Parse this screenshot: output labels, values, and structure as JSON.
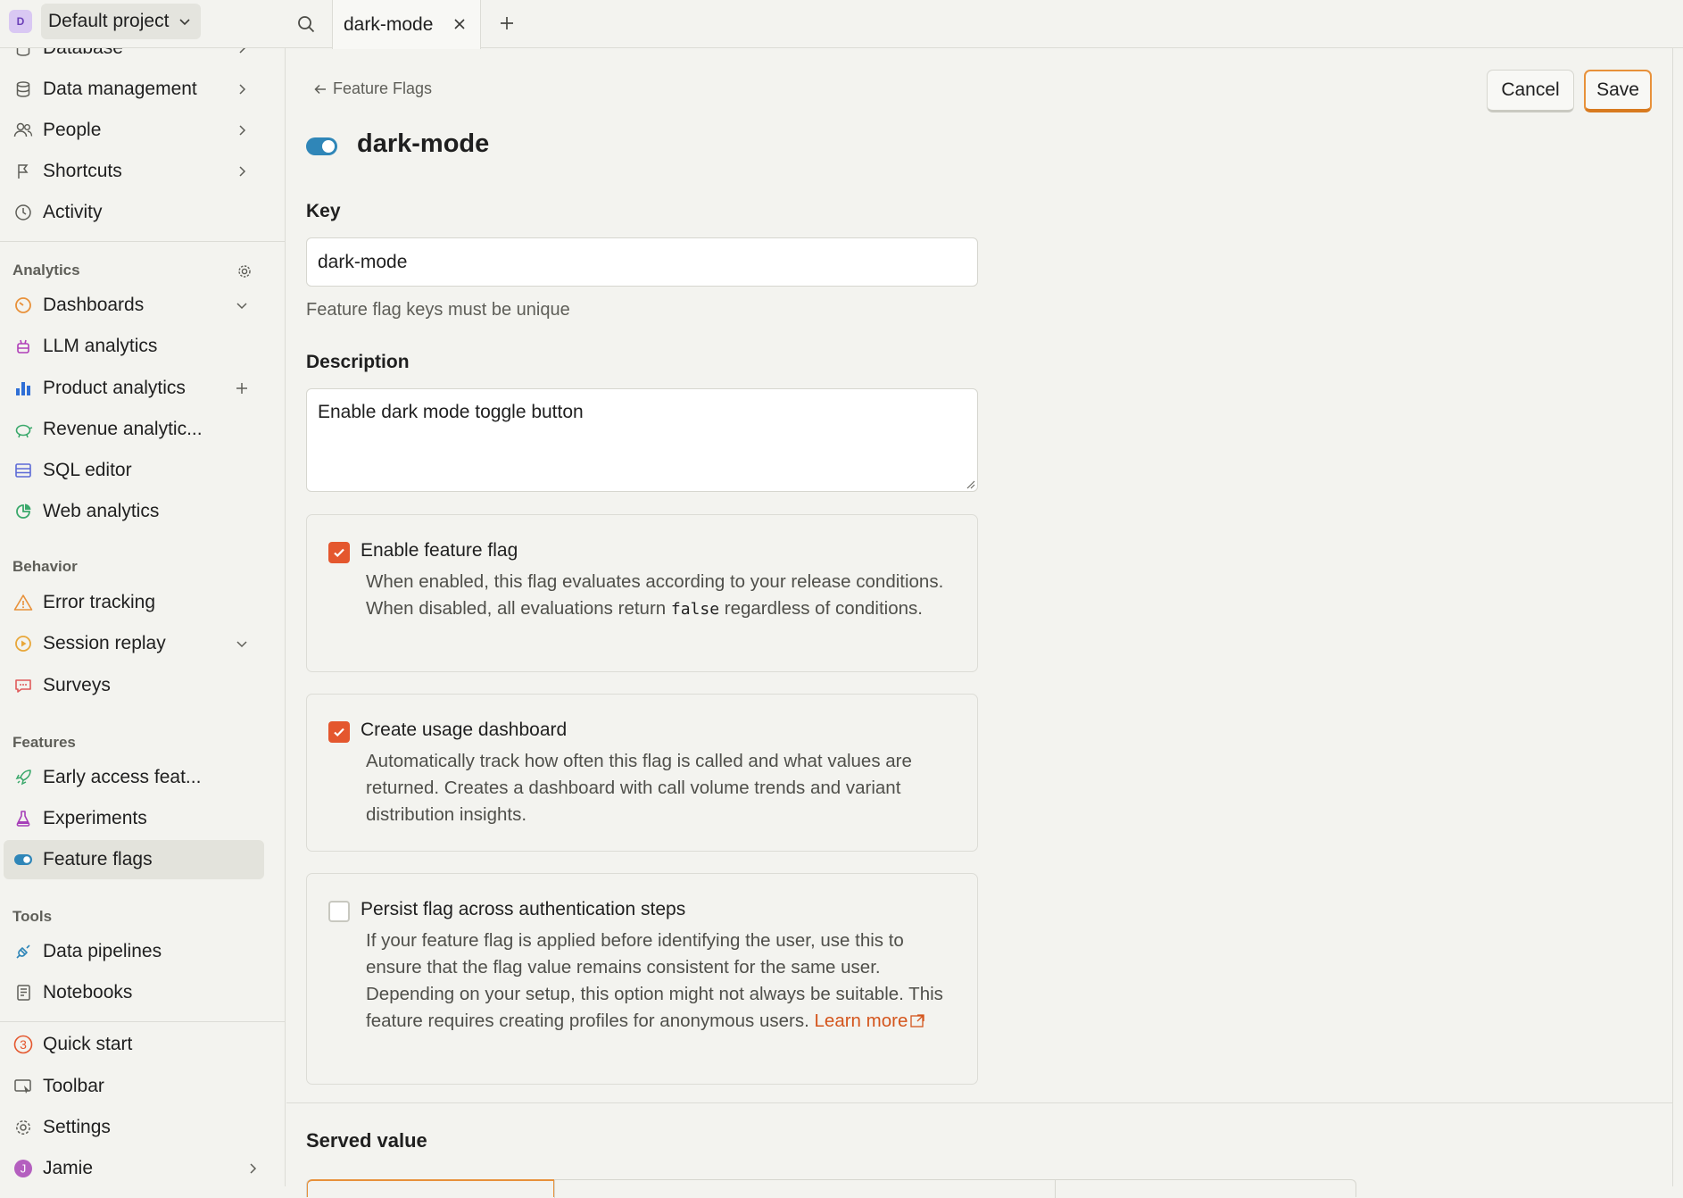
{
  "topbar": {
    "project_initial": "D",
    "project_name": "Default project",
    "active_tab": "dark-mode"
  },
  "sidebar": {
    "partial_top_item": "Database",
    "items_top": [
      {
        "label": "Data management"
      },
      {
        "label": "People"
      },
      {
        "label": "Shortcuts"
      },
      {
        "label": "Activity"
      }
    ],
    "analytics": {
      "section_label": "Analytics",
      "items": [
        {
          "label": "Dashboards"
        },
        {
          "label": "LLM analytics"
        },
        {
          "label": "Product analytics"
        },
        {
          "label": "Revenue analytic..."
        },
        {
          "label": "SQL editor"
        },
        {
          "label": "Web analytics"
        }
      ]
    },
    "behavior": {
      "section_label": "Behavior",
      "items": [
        {
          "label": "Error tracking"
        },
        {
          "label": "Session replay"
        },
        {
          "label": "Surveys"
        }
      ]
    },
    "features": {
      "section_label": "Features",
      "items": [
        {
          "label": "Early access feat..."
        },
        {
          "label": "Experiments"
        },
        {
          "label": "Feature flags"
        }
      ]
    },
    "tools": {
      "section_label": "Tools",
      "items": [
        {
          "label": "Data pipelines"
        },
        {
          "label": "Notebooks"
        }
      ]
    },
    "bottom_items": [
      {
        "label": "Quick start",
        "badge": "3"
      },
      {
        "label": "Toolbar"
      },
      {
        "label": "Settings"
      },
      {
        "label": "Jamie",
        "avatar_initial": "J"
      }
    ]
  },
  "main": {
    "back_link": "Feature Flags",
    "cancel_label": "Cancel",
    "save_label": "Save",
    "title": "dark-mode",
    "key": {
      "label": "Key",
      "value": "dark-mode",
      "hint": "Feature flag keys must be unique"
    },
    "description": {
      "label": "Description",
      "value": "Enable dark mode toggle button"
    },
    "options": [
      {
        "title": "Enable feature flag",
        "checked": true,
        "desc_before": "When enabled, this flag evaluates according to your release conditions. When disabled, all evaluations return ",
        "desc_code": "false",
        "desc_after": " regardless of conditions."
      },
      {
        "title": "Create usage dashboard",
        "checked": true,
        "desc": "Automatically track how often this flag is called and what values are returned. Creates a dashboard with call volume trends and variant distribution insights."
      },
      {
        "title": "Persist flag across authentication steps",
        "checked": false,
        "desc": "If your feature flag is applied before identifying the user, use this to ensure that the flag value remains consistent for the same user. Depending on your setup, this option might not always be suitable. This feature requires creating profiles for anonymous users.",
        "link": "Learn more"
      }
    ],
    "served_value_heading": "Served value"
  },
  "colors": {
    "accent_orange": "#e8913a",
    "checkbox_checked": "#e4572e",
    "toggle_on": "#2f86b8",
    "link": "#d4551c"
  }
}
